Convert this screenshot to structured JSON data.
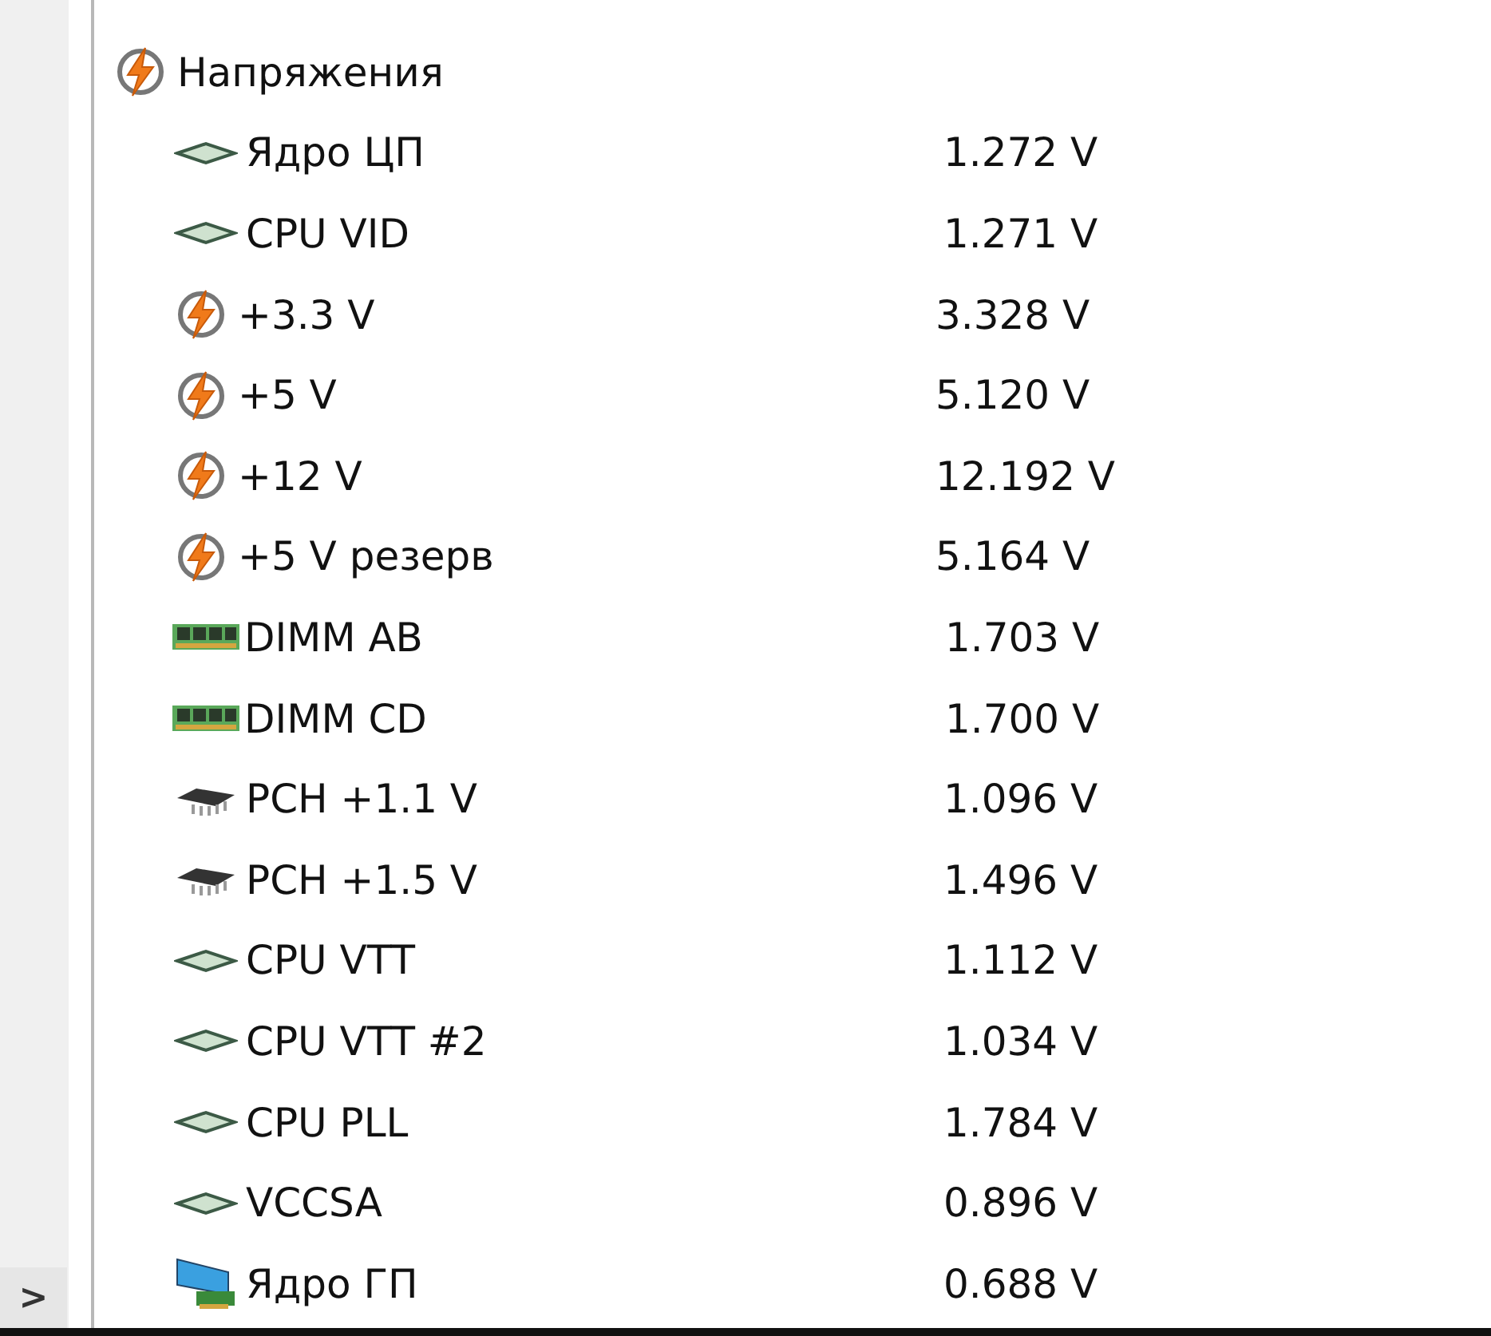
{
  "group": {
    "label": "Напряжения",
    "kind": "bolt"
  },
  "rows": [
    {
      "kind": "cpu",
      "label": "Ядро ЦП",
      "value": "1.272 V"
    },
    {
      "kind": "cpu",
      "label": "CPU VID",
      "value": "1.271 V"
    },
    {
      "kind": "bolt",
      "label": "+3.3 V",
      "value": "3.328 V"
    },
    {
      "kind": "bolt",
      "label": "+5 V",
      "value": "5.120 V"
    },
    {
      "kind": "bolt",
      "label": "+12 V",
      "value": "12.192 V"
    },
    {
      "kind": "bolt",
      "label": "+5 V резерв",
      "value": "5.164 V"
    },
    {
      "kind": "dimm",
      "label": "DIMM AB",
      "value": "1.703 V"
    },
    {
      "kind": "dimm",
      "label": "DIMM CD",
      "value": "1.700 V"
    },
    {
      "kind": "chip",
      "label": "PCH +1.1 V",
      "value": "1.096 V"
    },
    {
      "kind": "chip",
      "label": "PCH +1.5 V",
      "value": "1.496 V"
    },
    {
      "kind": "cpu",
      "label": "CPU VTT",
      "value": "1.112 V"
    },
    {
      "kind": "cpu",
      "label": "CPU VTT #2",
      "value": "1.034 V"
    },
    {
      "kind": "cpu",
      "label": "CPU PLL",
      "value": "1.784 V"
    },
    {
      "kind": "cpu",
      "label": "VCCSA",
      "value": "0.896 V"
    },
    {
      "kind": "gpu",
      "label": "Ядро ГП",
      "value": "0.688 V"
    }
  ],
  "expand_button": {
    "label": ">"
  }
}
